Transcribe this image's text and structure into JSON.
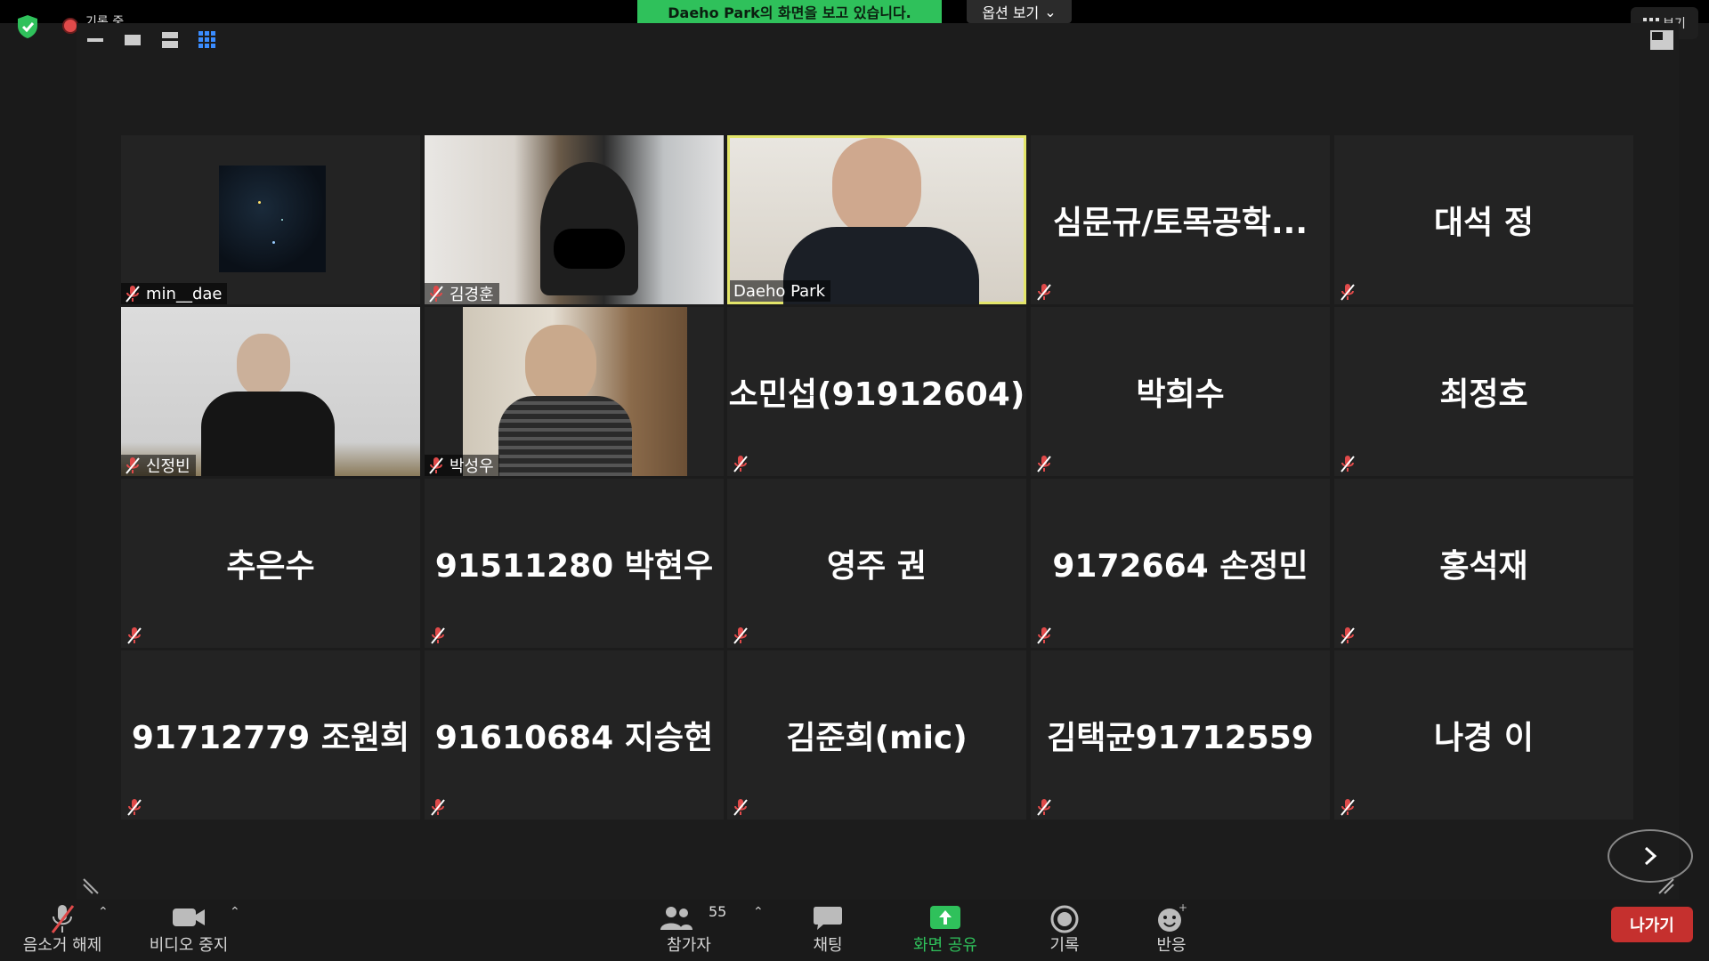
{
  "top": {
    "recording_label": "기록 중",
    "share_banner": "Daeho Park의 화면을 보고 있습니다.",
    "view_options": "옵션 보기",
    "view_button": "보기"
  },
  "tiles": [
    {
      "name": "min__dae",
      "big": ""
    },
    {
      "name": "김경훈",
      "big": ""
    },
    {
      "name": "Daeho Park",
      "big": ""
    },
    {
      "name": "",
      "big": "심문규/토목공학..."
    },
    {
      "name": "",
      "big": "대석 정"
    },
    {
      "name": "신정빈",
      "big": ""
    },
    {
      "name": "박성우",
      "big": ""
    },
    {
      "name": "",
      "big": "소민섭(91912604)"
    },
    {
      "name": "",
      "big": "박희수"
    },
    {
      "name": "",
      "big": "최정호"
    },
    {
      "name": "",
      "big": "추은수"
    },
    {
      "name": "",
      "big": "91511280 박현우"
    },
    {
      "name": "",
      "big": "영주 권"
    },
    {
      "name": "",
      "big": "9172664 손정민"
    },
    {
      "name": "",
      "big": "홍석재"
    },
    {
      "name": "",
      "big": "91712779 조원희"
    },
    {
      "name": "",
      "big": "91610684 지승현"
    },
    {
      "name": "",
      "big": "김준희(mic)"
    },
    {
      "name": "",
      "big": "김택균91712559"
    },
    {
      "name": "",
      "big": "나경 이"
    }
  ],
  "toolbar": {
    "unmute": "음소거 해제",
    "stop_video": "비디오 중지",
    "participants": "참가자",
    "participants_count": "55",
    "chat": "채팅",
    "share_screen": "화면 공유",
    "record": "기록",
    "reactions": "반응",
    "leave": "나가기"
  },
  "colors": {
    "share_green": "#2fc15b",
    "active_speaker": "#e3e56a",
    "leave_red": "#c5302e",
    "muted_red": "#e04a4a"
  }
}
